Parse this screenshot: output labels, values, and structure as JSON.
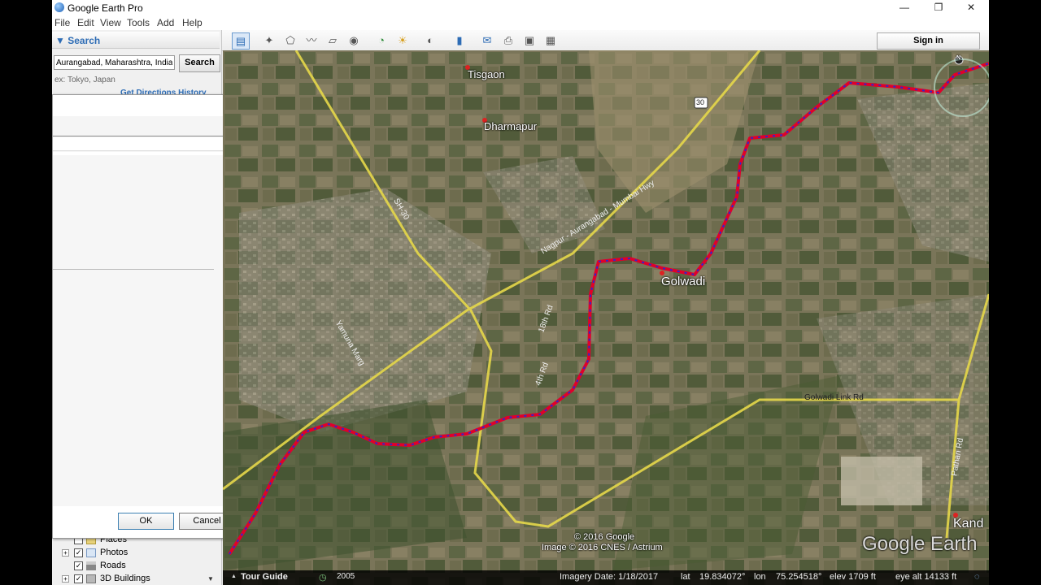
{
  "window": {
    "title": "Google Earth Pro",
    "controls": [
      "—",
      "❐",
      "✕"
    ]
  },
  "menu": [
    "File",
    "Edit",
    "View",
    "Tools",
    "Add",
    "Help"
  ],
  "search": {
    "header": "▼ Search",
    "input_value": "Aurangabad, Maharashtra, India",
    "button_label": "Search",
    "hint": "ex: Tokyo, Japan",
    "links": "Get Directions  History"
  },
  "dialog": {
    "ok_label": "OK",
    "cancel_label": "Cancel"
  },
  "places_tree": [
    {
      "label": "Places",
      "checked": false,
      "expand": ""
    },
    {
      "label": "Photos",
      "checked": true,
      "expand": "+"
    },
    {
      "label": "Roads",
      "checked": true,
      "expand": ""
    },
    {
      "label": "3D Buildings",
      "checked": true,
      "expand": "+"
    }
  ],
  "toolbar": {
    "signin_label": "Sign in"
  },
  "map": {
    "places": {
      "tisgaon": "Tisgaon",
      "dharmapur": "Dharmapur",
      "golwadi": "Golwadi",
      "kand": "Kand"
    },
    "roads": {
      "highway_shield": "30",
      "nh": "Nagpur - Aurangabad - Mumbai Hwy",
      "sh": "SH-30",
      "yamuna": "Yamuna Marg",
      "r18": "18th Rd",
      "r4": "4th Rd",
      "golwadi_link": "Golwadi Link Rd",
      "pathan": "Pathan Rd"
    },
    "compass": "N",
    "copyright_google": "© 2016 Google",
    "copyright_image": "Image © 2016 CNES / Astrium",
    "watermark": "Google Earth"
  },
  "status": {
    "tour_guide": "Tour Guide",
    "year": "2005",
    "imagery_date": "Imagery Date: 1/18/2017",
    "lat_label": "lat",
    "lat_value": "19.834072°",
    "lon_label": "lon",
    "lon_value": "75.254518°",
    "elev": "elev  1709 ft",
    "eye_alt": "eye alt  14133 ft"
  }
}
